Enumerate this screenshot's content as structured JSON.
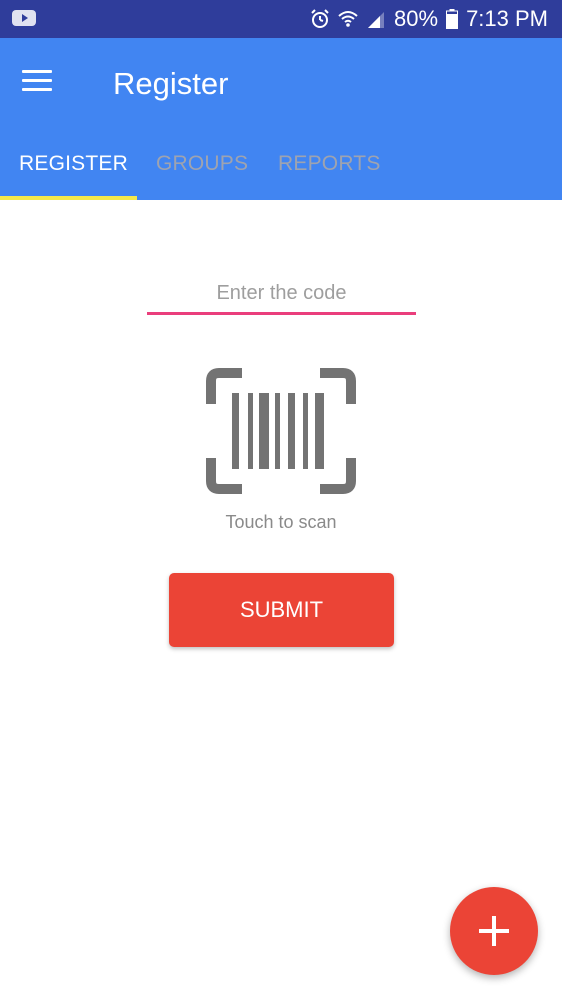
{
  "status_bar": {
    "battery": "80%",
    "time": "7:13 PM",
    "icons": [
      "youtube-icon",
      "alarm-icon",
      "wifi-icon",
      "signal-icon",
      "battery-icon"
    ]
  },
  "app_bar": {
    "title": "Register",
    "color": "#4185f2"
  },
  "tabs": [
    {
      "label": "REGISTER",
      "active": true
    },
    {
      "label": "GROUPS",
      "active": false
    },
    {
      "label": "REPORTS",
      "active": false
    }
  ],
  "form": {
    "code_placeholder": "Enter the code",
    "code_value": "",
    "scan_label": "Touch to scan",
    "submit_label": "SUBMIT",
    "submit_color": "#eb4436"
  },
  "fab": {
    "icon": "plus-icon",
    "color": "#eb4436"
  }
}
